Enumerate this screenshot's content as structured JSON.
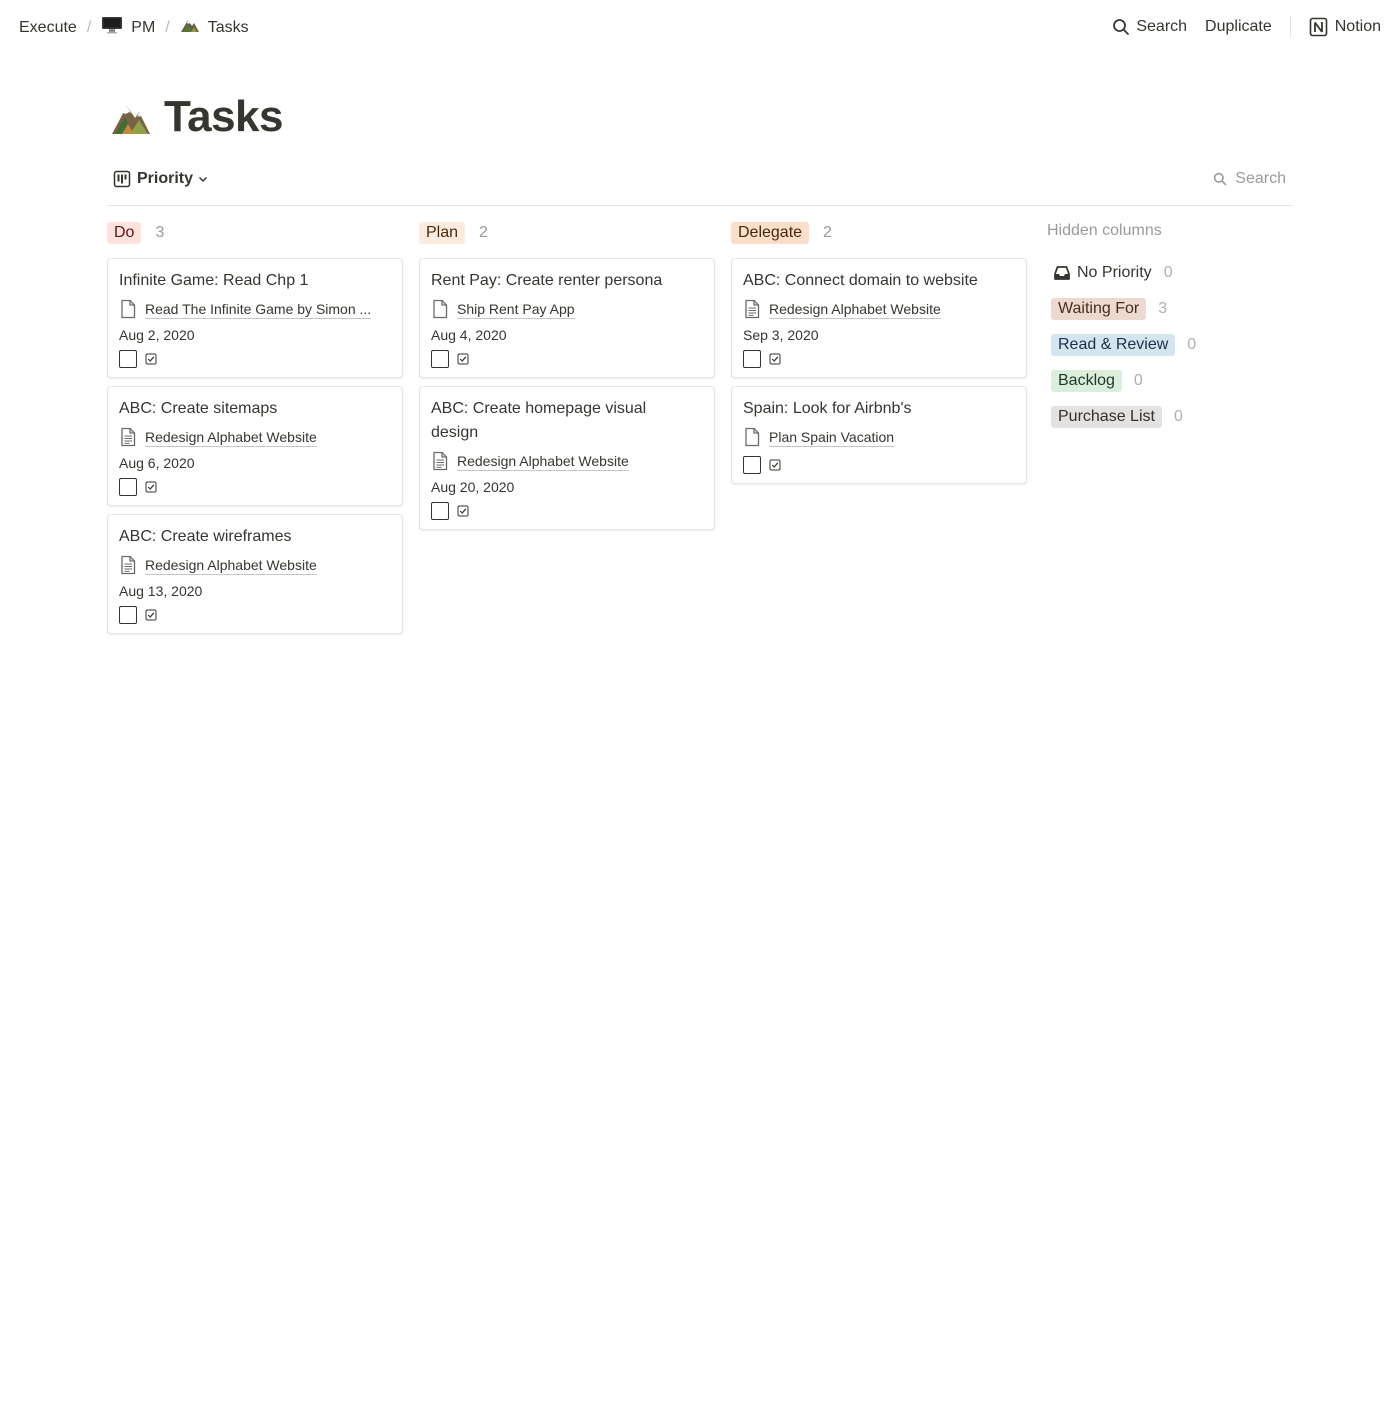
{
  "breadcrumb": {
    "items": [
      {
        "label": "Execute",
        "icon": "none"
      },
      {
        "label": "PM",
        "icon": "computer-icon"
      },
      {
        "label": "Tasks",
        "icon": "mountain-icon"
      }
    ],
    "separator": "/"
  },
  "topbar": {
    "search_label": "Search",
    "duplicate_label": "Duplicate",
    "notion_label": "Notion"
  },
  "page": {
    "title": "Tasks",
    "icon": "mountain-icon"
  },
  "view": {
    "group_label": "Priority",
    "search_label": "Search"
  },
  "columns": [
    {
      "label": "Do",
      "count": "3",
      "color": "#ffe2dd",
      "text_color": "#5d1715",
      "cards": [
        {
          "title": "Infinite Game: Read Chp 1",
          "relation": "Read The Infinite Game by Simon ...",
          "relation_icon": "blank-doc-icon",
          "date": "Aug 2, 2020"
        },
        {
          "title": "ABC: Create sitemaps",
          "relation": "Redesign Alphabet Website",
          "relation_icon": "text-doc-icon",
          "date": "Aug 6, 2020"
        },
        {
          "title": "ABC: Create wireframes",
          "relation": "Redesign Alphabet Website",
          "relation_icon": "text-doc-icon",
          "date": "Aug 13, 2020"
        }
      ]
    },
    {
      "label": "Plan",
      "count": "2",
      "color": "#fbecdd",
      "text_color": "#49290e",
      "cards": [
        {
          "title": "Rent Pay: Create renter persona",
          "relation": "Ship Rent Pay App",
          "relation_icon": "blank-doc-icon",
          "date": "Aug 4, 2020"
        },
        {
          "title": "ABC: Create homepage visual design",
          "relation": "Redesign Alphabet Website",
          "relation_icon": "text-doc-icon",
          "date": "Aug 20, 2020"
        }
      ]
    },
    {
      "label": "Delegate",
      "count": "2",
      "color": "#fadec9",
      "text_color": "#49290e",
      "cards": [
        {
          "title": "ABC: Connect domain to website",
          "relation": "Redesign Alphabet Website",
          "relation_icon": "text-doc-icon",
          "date": "Sep 3, 2020"
        },
        {
          "title": "Spain: Look for Airbnb's",
          "relation": "Plan Spain Vacation",
          "relation_icon": "blank-doc-icon",
          "date": ""
        }
      ]
    }
  ],
  "hidden_columns": {
    "title": "Hidden columns",
    "no_priority": {
      "label": "No Priority",
      "count": "0",
      "icon": "inbox-icon"
    },
    "items": [
      {
        "label": "Waiting For",
        "count": "3",
        "color": "#ecd9cf"
      },
      {
        "label": "Read & Review",
        "count": "0",
        "color": "#d3e5ef"
      },
      {
        "label": "Backlog",
        "count": "0",
        "color": "#dbeddb"
      },
      {
        "label": "Purchase List",
        "count": "0",
        "color": "#e3e2e0"
      }
    ]
  }
}
